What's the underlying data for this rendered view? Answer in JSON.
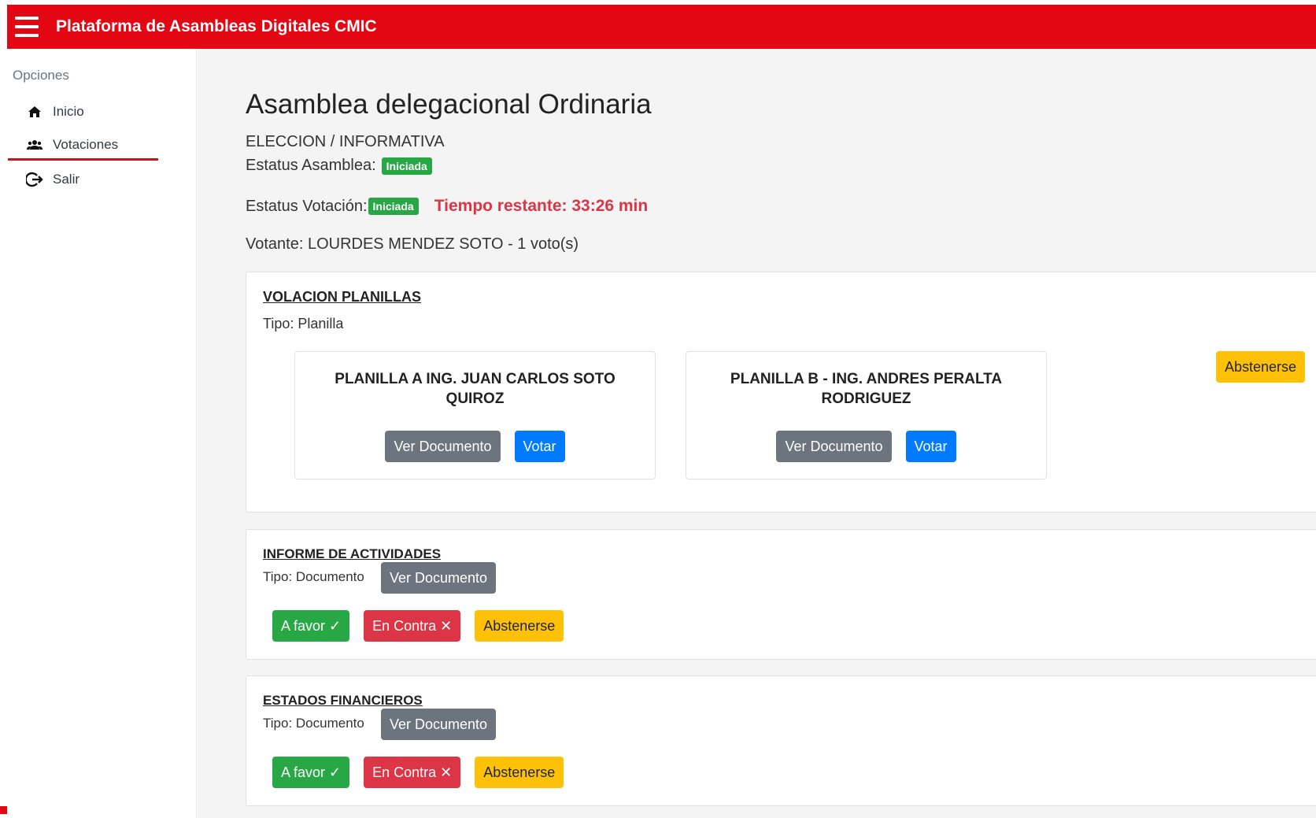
{
  "app": {
    "title": "Plataforma de Asambleas Digitales CMIC"
  },
  "sidebar": {
    "heading": "Opciones",
    "items": [
      {
        "label": "Inicio",
        "icon": "home-icon"
      },
      {
        "label": "Votaciones",
        "icon": "users-icon"
      },
      {
        "label": "Salir",
        "icon": "logout-icon"
      }
    ]
  },
  "colors": {
    "brand": "#e30613",
    "badge": "#28a745",
    "timer": "#dc3545",
    "primary": "#007bff",
    "secondary": "#6c757d",
    "warning": "#ffc107"
  },
  "assembly": {
    "title": "Asamblea delegacional Ordinaria",
    "type": "ELECCION / INFORMATIVA",
    "status_label": "Estatus Asamblea:",
    "status_badge": "Iniciada",
    "vote_status_label": "Estatus Votación:",
    "vote_status_badge": "Iniciada",
    "timer": "Tiempo restante: 33:26 min",
    "voter": "Votante: LOURDES MENDEZ SOTO - 1 voto(s)"
  },
  "items": [
    {
      "title": "VOLACION PLANILLAS",
      "type": "Tipo: Planilla",
      "abstain_label": "Abstenerse",
      "options": [
        {
          "name": "PLANILLA A ING. JUAN CARLOS SOTO QUIROZ",
          "doc_label": "Ver Documento",
          "vote_label": "Votar"
        },
        {
          "name": "PLANILLA B - ING. ANDRES PERALTA RODRIGUEZ",
          "doc_label": "Ver Documento",
          "vote_label": "Votar"
        }
      ]
    },
    {
      "title": "INFORME DE ACTIVIDADES",
      "type": "Tipo: Documento",
      "doc_label": "Ver Documento",
      "favor_label": "A favor ✓",
      "contra_label": "En Contra ✕",
      "abstain_label": "Abstenerse"
    },
    {
      "title": "ESTADOS FINANCIEROS",
      "type": "Tipo: Documento",
      "doc_label": "Ver Documento",
      "favor_label": "A favor ✓",
      "contra_label": "En Contra ✕",
      "abstain_label": "Abstenerse"
    }
  ]
}
